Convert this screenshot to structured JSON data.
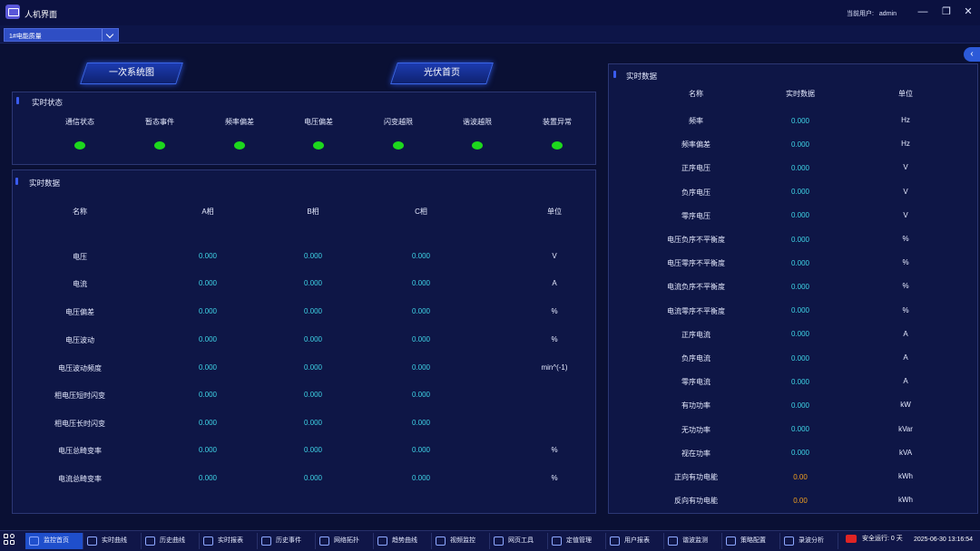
{
  "titlebar": {
    "app_title": "人机界面",
    "user_label": "当前用户:",
    "user_name": "admin",
    "minimize": "—",
    "restore": "❐",
    "close": "✕"
  },
  "toolbar": {
    "device_select_value": "1#电能质量"
  },
  "nav": {
    "primary_diagram": "一次系统图",
    "pv_home": "光伏首页",
    "collapse_icon": "‹"
  },
  "status_panel": {
    "title": "实时状态",
    "items": [
      {
        "label": "通信状态",
        "state": "ok"
      },
      {
        "label": "暂态事件",
        "state": "ok"
      },
      {
        "label": "频率偏差",
        "state": "ok"
      },
      {
        "label": "电压偏差",
        "state": "ok"
      },
      {
        "label": "闪变越限",
        "state": "ok"
      },
      {
        "label": "谐波越限",
        "state": "ok"
      },
      {
        "label": "装置异常",
        "state": "ok"
      }
    ],
    "ok_color": "#1dd81d"
  },
  "phase_panel": {
    "title": "实时数据",
    "headers": [
      "名称",
      "A相",
      "B相",
      "C相",
      "单位"
    ],
    "rows": [
      {
        "name": "电压",
        "a": "0.000",
        "b": "0.000",
        "c": "0.000",
        "unit": "V"
      },
      {
        "name": "电流",
        "a": "0.000",
        "b": "0.000",
        "c": "0.000",
        "unit": "A"
      },
      {
        "name": "电压偏差",
        "a": "0.000",
        "b": "0.000",
        "c": "0.000",
        "unit": "%"
      },
      {
        "name": "电压波动",
        "a": "0.000",
        "b": "0.000",
        "c": "0.000",
        "unit": "%"
      },
      {
        "name": "电压波动频度",
        "a": "0.000",
        "b": "0.000",
        "c": "0.000",
        "unit": "min^(-1)"
      },
      {
        "name": "相电压短时闪变",
        "a": "0.000",
        "b": "0.000",
        "c": "0.000",
        "unit": ""
      },
      {
        "name": "相电压长时闪变",
        "a": "0.000",
        "b": "0.000",
        "c": "0.000",
        "unit": ""
      },
      {
        "name": "电压总畸变率",
        "a": "0.000",
        "b": "0.000",
        "c": "0.000",
        "unit": "%"
      },
      {
        "name": "电流总畸变率",
        "a": "0.000",
        "b": "0.000",
        "c": "0.000",
        "unit": "%"
      }
    ]
  },
  "right_panel": {
    "title": "实时数据",
    "headers": [
      "名称",
      "实时数据",
      "单位"
    ],
    "rows": [
      {
        "name": "频率",
        "value": "0.000",
        "unit": "Hz",
        "highlight": false
      },
      {
        "name": "频率偏差",
        "value": "0.000",
        "unit": "Hz",
        "highlight": false
      },
      {
        "name": "正序电压",
        "value": "0.000",
        "unit": "V",
        "highlight": false
      },
      {
        "name": "负序电压",
        "value": "0.000",
        "unit": "V",
        "highlight": false
      },
      {
        "name": "零序电压",
        "value": "0.000",
        "unit": "V",
        "highlight": false
      },
      {
        "name": "电压负序不平衡度",
        "value": "0.000",
        "unit": "%",
        "highlight": false
      },
      {
        "name": "电压零序不平衡度",
        "value": "0.000",
        "unit": "%",
        "highlight": false
      },
      {
        "name": "电流负序不平衡度",
        "value": "0.000",
        "unit": "%",
        "highlight": false
      },
      {
        "name": "电流零序不平衡度",
        "value": "0.000",
        "unit": "%",
        "highlight": false
      },
      {
        "name": "正序电流",
        "value": "0.000",
        "unit": "A",
        "highlight": false
      },
      {
        "name": "负序电流",
        "value": "0.000",
        "unit": "A",
        "highlight": false
      },
      {
        "name": "零序电流",
        "value": "0.000",
        "unit": "A",
        "highlight": false
      },
      {
        "name": "有功功率",
        "value": "0.000",
        "unit": "kW",
        "highlight": false
      },
      {
        "name": "无功功率",
        "value": "0.000",
        "unit": "kVar",
        "highlight": false
      },
      {
        "name": "视在功率",
        "value": "0.000",
        "unit": "kVA",
        "highlight": false
      },
      {
        "name": "正向有功电能",
        "value": "0.00",
        "unit": "kWh",
        "highlight": true
      },
      {
        "name": "反向有功电能",
        "value": "0.00",
        "unit": "kWh",
        "highlight": true
      }
    ]
  },
  "taskbar": {
    "items": [
      {
        "label": "监控首页",
        "icon": "home-icon",
        "active": true
      },
      {
        "label": "实时曲线",
        "icon": "line-chart-icon",
        "active": false
      },
      {
        "label": "历史曲线",
        "icon": "history-chart-icon",
        "active": false
      },
      {
        "label": "实时报表",
        "icon": "report-icon",
        "active": false
      },
      {
        "label": "历史事件",
        "icon": "event-icon",
        "active": false
      },
      {
        "label": "网络拓扑",
        "icon": "topology-icon",
        "active": false
      },
      {
        "label": "趋势曲线",
        "icon": "trend-icon",
        "active": false
      },
      {
        "label": "视频监控",
        "icon": "video-icon",
        "active": false
      },
      {
        "label": "网页工具",
        "icon": "web-icon",
        "active": false
      },
      {
        "label": "定值管理",
        "icon": "setting-value-icon",
        "active": false
      },
      {
        "label": "用户报表",
        "icon": "user-report-icon",
        "active": false
      },
      {
        "label": "谐波监测",
        "icon": "harmonic-icon",
        "active": false
      },
      {
        "label": "策略配置",
        "icon": "strategy-icon",
        "active": false
      },
      {
        "label": "录波分析",
        "icon": "waveform-icon",
        "active": false
      }
    ],
    "safety_text": "安全运行: 0 天",
    "datetime": "2025-06-30 13:16:54"
  }
}
